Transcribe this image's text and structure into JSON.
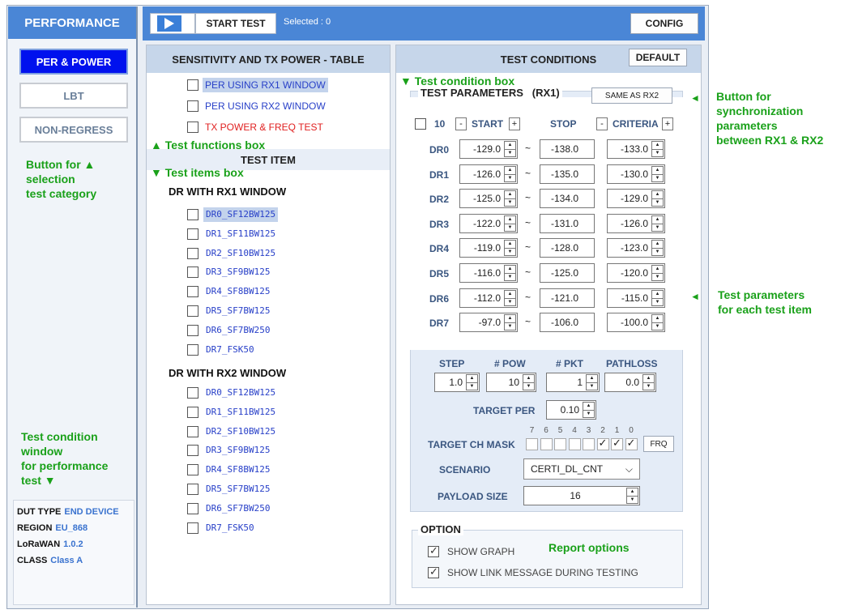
{
  "sidebar": {
    "title": "PERFORMANCE",
    "categories": [
      "PER & POWER",
      "LBT",
      "NON-REGRESS"
    ],
    "annotation_select": [
      "Button for ▲",
      "selection",
      "test category"
    ],
    "annotation_condition": [
      "Test condition",
      "window",
      "for performance",
      "test ▼"
    ],
    "dut": [
      {
        "label": "DUT TYPE",
        "value": "END DEVICE"
      },
      {
        "label": "REGION",
        "value": "EU_868"
      },
      {
        "label": "LoRaWAN",
        "value": "1.0.2"
      },
      {
        "label": "CLASS",
        "value": "Class A"
      }
    ]
  },
  "topbar": {
    "start_label": "START TEST",
    "selected": "Selected : 0",
    "config_label": "CONFIG"
  },
  "left_panel": {
    "title": "SENSITIVITY AND TX POWER - TABLE",
    "functions": [
      "PER USING RX1 WINDOW",
      "PER USING RX2 WINDOW",
      "TX POWER & FREQ TEST"
    ],
    "functions_note": "▲ Test functions box",
    "test_item_header": "TEST ITEM",
    "items_note": "▼ Test items box",
    "rx1_title": "DR WITH RX1 WINDOW",
    "rx1_items": [
      "DR0_SF12BW125",
      "DR1_SF11BW125",
      "DR2_SF10BW125",
      "DR3_SF9BW125",
      "DR4_SF8BW125",
      "DR5_SF7BW125",
      "DR6_SF7BW250",
      "DR7_FSK50"
    ],
    "rx2_title": "DR WITH RX2 WINDOW",
    "rx2_items": [
      "DR0_SF12BW125",
      "DR1_SF11BW125",
      "DR2_SF10BW125",
      "DR3_SF9BW125",
      "DR4_SF8BW125",
      "DR5_SF7BW125",
      "DR6_SF7BW250",
      "DR7_FSK50"
    ]
  },
  "right_panel": {
    "title": "TEST CONDITIONS",
    "default_label": "DEFAULT",
    "condition_note": "▼ Test condition box",
    "params_title": "TEST PARAMETERS",
    "params_window": "(RX1)",
    "same_label": "SAME AS RX2",
    "count": "10",
    "minus": "-",
    "plus": "+",
    "tilde": "~",
    "col_start": "START",
    "col_stop": "STOP",
    "col_criteria": "CRITERIA",
    "rows": [
      {
        "dr": "DR0",
        "start": "-129.0",
        "stop": "-138.0",
        "criteria": "-133.0"
      },
      {
        "dr": "DR1",
        "start": "-126.0",
        "stop": "-135.0",
        "criteria": "-130.0"
      },
      {
        "dr": "DR2",
        "start": "-125.0",
        "stop": "-134.0",
        "criteria": "-129.0"
      },
      {
        "dr": "DR3",
        "start": "-122.0",
        "stop": "-131.0",
        "criteria": "-126.0"
      },
      {
        "dr": "DR4",
        "start": "-119.0",
        "stop": "-128.0",
        "criteria": "-123.0"
      },
      {
        "dr": "DR5",
        "start": "-116.0",
        "stop": "-125.0",
        "criteria": "-120.0"
      },
      {
        "dr": "DR6",
        "start": "-112.0",
        "stop": "-121.0",
        "criteria": "-115.0"
      },
      {
        "dr": "DR7",
        "start": "-97.0",
        "stop": "-106.0",
        "criteria": "-100.0"
      }
    ],
    "step_label": "STEP",
    "step": "1.0",
    "pow_label": "# POW",
    "pow": "10",
    "pkt_label": "# PKT",
    "pkt": "1",
    "pathloss_label": "PATHLOSS",
    "pathloss": "0.0",
    "target_per_label": "TARGET PER",
    "target_per": "0.10",
    "mask_label": "TARGET CH MASK",
    "mask_bits": [
      "7",
      "6",
      "5",
      "4",
      "3",
      "2",
      "1",
      "0"
    ],
    "mask_on": [
      false,
      false,
      false,
      false,
      false,
      true,
      true,
      true
    ],
    "frq_label": "FRQ",
    "scenario_label": "SCENARIO",
    "scenario": "CERTI_DL_CNT",
    "payload_label": "PAYLOAD SIZE",
    "payload": "16",
    "option_title": "OPTION",
    "options": [
      {
        "label": "SHOW GRAPH",
        "checked": true
      },
      {
        "label": "SHOW LINK MESSAGE DURING TESTING",
        "checked": true
      }
    ],
    "report_note": "Report  options"
  },
  "annotations": {
    "sync": [
      "Button for",
      "synchronization",
      "parameters",
      "between RX1 & RX2"
    ],
    "params": [
      "Test parameters",
      "for each test item"
    ]
  },
  "colors": {
    "accent": "#4a86d6",
    "active": "#0011ee",
    "note": "#1aa11a",
    "item": "#2840c8",
    "tx": "#e02020"
  }
}
